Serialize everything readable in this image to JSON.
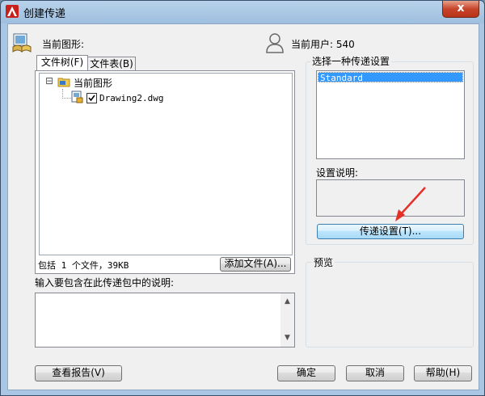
{
  "window": {
    "title": "创建传递",
    "close_label": "x"
  },
  "header": {
    "current_drawing_label": "当前图形:",
    "current_user_label": "当前用户: 540"
  },
  "tabs": [
    {
      "label": "文件树(F)",
      "active": true
    },
    {
      "label": "文件表(B)",
      "active": false
    }
  ],
  "tree": {
    "root_label": "当前图形",
    "root_expander": "⊟",
    "child_label": "Drawing2.dwg",
    "child_checked": true
  },
  "summary": {
    "text": "包括 1 个文件，39KB",
    "add_file_button": "添加文件(A)..."
  },
  "notes": {
    "label": "输入要包含在此传递包中的说明:"
  },
  "settings": {
    "group_label": "选择一种传递设置",
    "items": [
      "Standard"
    ],
    "selected": "Standard",
    "description_label": "设置说明:",
    "setup_button": "传递设置(T)..."
  },
  "preview": {
    "label": "预览"
  },
  "footer": {
    "report_button": "查看报告(V)",
    "ok_button": "确定",
    "cancel_button": "取消",
    "help_button": "帮助(H)"
  },
  "colors": {
    "accent_selection": "#3399ff",
    "annotation_arrow": "#e5302a"
  }
}
